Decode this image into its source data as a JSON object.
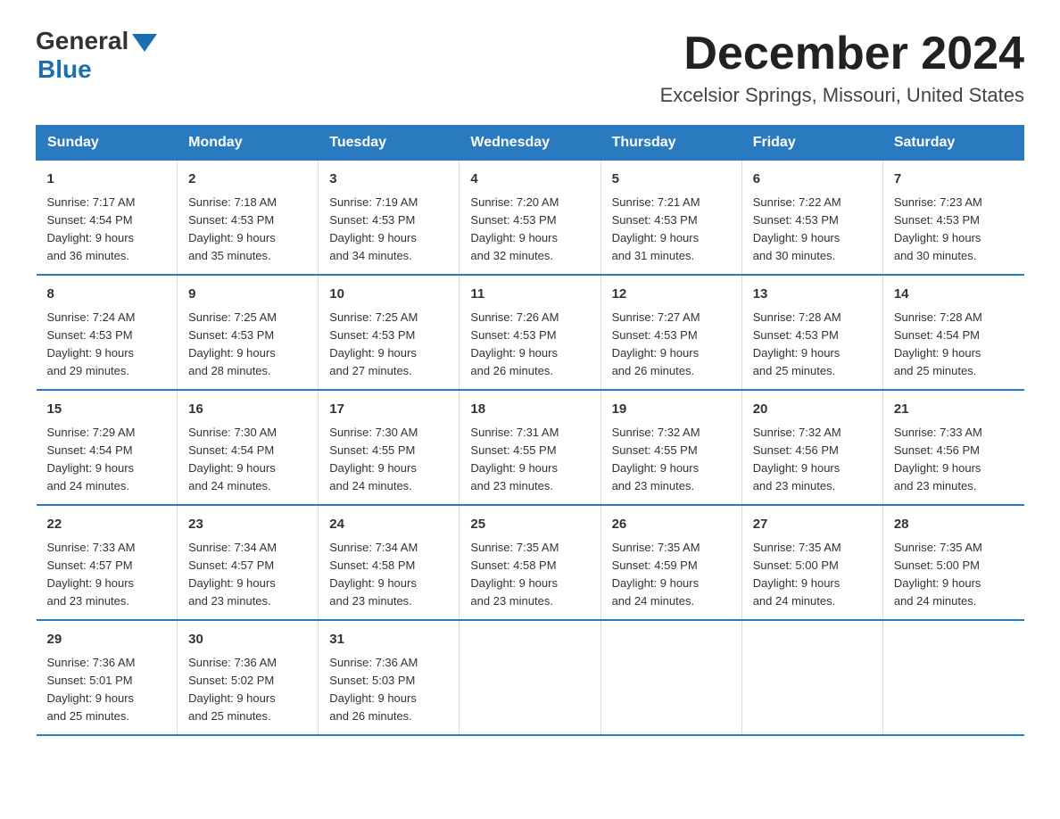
{
  "logo": {
    "general": "General",
    "blue": "Blue"
  },
  "title": {
    "month": "December 2024",
    "location": "Excelsior Springs, Missouri, United States"
  },
  "weekdays": [
    "Sunday",
    "Monday",
    "Tuesday",
    "Wednesday",
    "Thursday",
    "Friday",
    "Saturday"
  ],
  "weeks": [
    [
      {
        "day": "1",
        "sunrise": "7:17 AM",
        "sunset": "4:54 PM",
        "daylight": "9 hours and 36 minutes."
      },
      {
        "day": "2",
        "sunrise": "7:18 AM",
        "sunset": "4:53 PM",
        "daylight": "9 hours and 35 minutes."
      },
      {
        "day": "3",
        "sunrise": "7:19 AM",
        "sunset": "4:53 PM",
        "daylight": "9 hours and 34 minutes."
      },
      {
        "day": "4",
        "sunrise": "7:20 AM",
        "sunset": "4:53 PM",
        "daylight": "9 hours and 32 minutes."
      },
      {
        "day": "5",
        "sunrise": "7:21 AM",
        "sunset": "4:53 PM",
        "daylight": "9 hours and 31 minutes."
      },
      {
        "day": "6",
        "sunrise": "7:22 AM",
        "sunset": "4:53 PM",
        "daylight": "9 hours and 30 minutes."
      },
      {
        "day": "7",
        "sunrise": "7:23 AM",
        "sunset": "4:53 PM",
        "daylight": "9 hours and 30 minutes."
      }
    ],
    [
      {
        "day": "8",
        "sunrise": "7:24 AM",
        "sunset": "4:53 PM",
        "daylight": "9 hours and 29 minutes."
      },
      {
        "day": "9",
        "sunrise": "7:25 AM",
        "sunset": "4:53 PM",
        "daylight": "9 hours and 28 minutes."
      },
      {
        "day": "10",
        "sunrise": "7:25 AM",
        "sunset": "4:53 PM",
        "daylight": "9 hours and 27 minutes."
      },
      {
        "day": "11",
        "sunrise": "7:26 AM",
        "sunset": "4:53 PM",
        "daylight": "9 hours and 26 minutes."
      },
      {
        "day": "12",
        "sunrise": "7:27 AM",
        "sunset": "4:53 PM",
        "daylight": "9 hours and 26 minutes."
      },
      {
        "day": "13",
        "sunrise": "7:28 AM",
        "sunset": "4:53 PM",
        "daylight": "9 hours and 25 minutes."
      },
      {
        "day": "14",
        "sunrise": "7:28 AM",
        "sunset": "4:54 PM",
        "daylight": "9 hours and 25 minutes."
      }
    ],
    [
      {
        "day": "15",
        "sunrise": "7:29 AM",
        "sunset": "4:54 PM",
        "daylight": "9 hours and 24 minutes."
      },
      {
        "day": "16",
        "sunrise": "7:30 AM",
        "sunset": "4:54 PM",
        "daylight": "9 hours and 24 minutes."
      },
      {
        "day": "17",
        "sunrise": "7:30 AM",
        "sunset": "4:55 PM",
        "daylight": "9 hours and 24 minutes."
      },
      {
        "day": "18",
        "sunrise": "7:31 AM",
        "sunset": "4:55 PM",
        "daylight": "9 hours and 23 minutes."
      },
      {
        "day": "19",
        "sunrise": "7:32 AM",
        "sunset": "4:55 PM",
        "daylight": "9 hours and 23 minutes."
      },
      {
        "day": "20",
        "sunrise": "7:32 AM",
        "sunset": "4:56 PM",
        "daylight": "9 hours and 23 minutes."
      },
      {
        "day": "21",
        "sunrise": "7:33 AM",
        "sunset": "4:56 PM",
        "daylight": "9 hours and 23 minutes."
      }
    ],
    [
      {
        "day": "22",
        "sunrise": "7:33 AM",
        "sunset": "4:57 PM",
        "daylight": "9 hours and 23 minutes."
      },
      {
        "day": "23",
        "sunrise": "7:34 AM",
        "sunset": "4:57 PM",
        "daylight": "9 hours and 23 minutes."
      },
      {
        "day": "24",
        "sunrise": "7:34 AM",
        "sunset": "4:58 PM",
        "daylight": "9 hours and 23 minutes."
      },
      {
        "day": "25",
        "sunrise": "7:35 AM",
        "sunset": "4:58 PM",
        "daylight": "9 hours and 23 minutes."
      },
      {
        "day": "26",
        "sunrise": "7:35 AM",
        "sunset": "4:59 PM",
        "daylight": "9 hours and 24 minutes."
      },
      {
        "day": "27",
        "sunrise": "7:35 AM",
        "sunset": "5:00 PM",
        "daylight": "9 hours and 24 minutes."
      },
      {
        "day": "28",
        "sunrise": "7:35 AM",
        "sunset": "5:00 PM",
        "daylight": "9 hours and 24 minutes."
      }
    ],
    [
      {
        "day": "29",
        "sunrise": "7:36 AM",
        "sunset": "5:01 PM",
        "daylight": "9 hours and 25 minutes."
      },
      {
        "day": "30",
        "sunrise": "7:36 AM",
        "sunset": "5:02 PM",
        "daylight": "9 hours and 25 minutes."
      },
      {
        "day": "31",
        "sunrise": "7:36 AM",
        "sunset": "5:03 PM",
        "daylight": "9 hours and 26 minutes."
      },
      null,
      null,
      null,
      null
    ]
  ],
  "labels": {
    "sunrise": "Sunrise:",
    "sunset": "Sunset:",
    "daylight": "Daylight:"
  }
}
